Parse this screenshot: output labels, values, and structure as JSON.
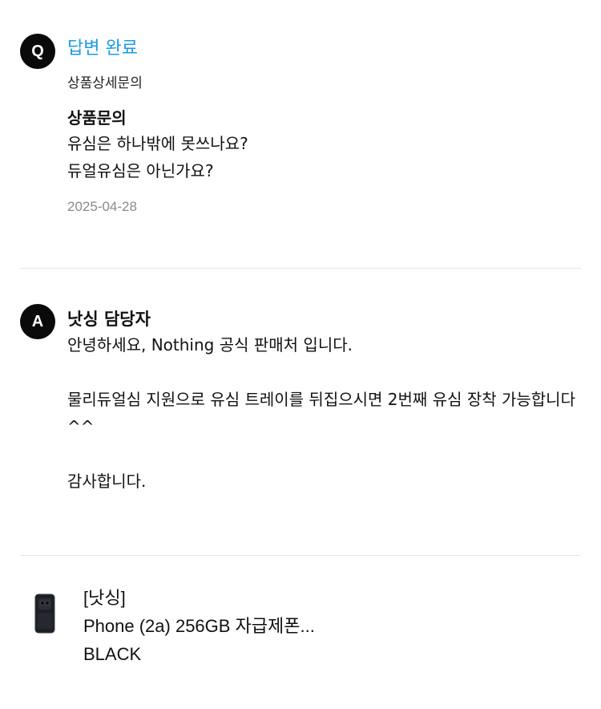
{
  "question": {
    "badge": "Q",
    "status": "답변 완료",
    "category": "상품상세문의",
    "title": "상품문의",
    "body_lines": [
      "유심은 하나밖에 못쓰나요?",
      "듀얼유심은 아닌가요?"
    ],
    "date": "2025-04-28"
  },
  "answer": {
    "badge": "A",
    "author": "낫싱 담당자",
    "paragraphs": [
      "안녕하세요, Nothing 공식 판매처 입니다.",
      "물리듀얼심 지원으로 유심 트레이를 뒤집으시면 2번째 유심 장착 가능합니다^^",
      "감사합니다."
    ]
  },
  "product": {
    "brand": "[낫싱]",
    "name": "Phone (2a) 256GB 자급제폰...",
    "option": "BLACK",
    "thumbnail_icon": "phone-thumbnail-icon"
  },
  "colors": {
    "status": "#1a9be6",
    "badge_bg": "#0a0a0a",
    "date": "#8a8a8a",
    "divider": "#e6e6e6"
  }
}
